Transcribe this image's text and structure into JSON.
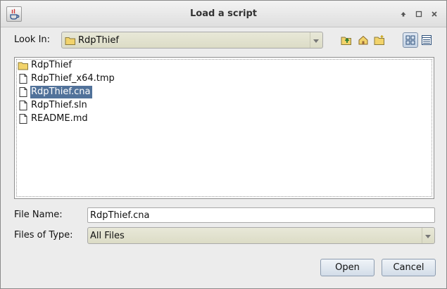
{
  "window": {
    "title": "Load a script"
  },
  "window_controls": [
    "maximize",
    "restore",
    "close"
  ],
  "look_in": {
    "label": "Look In:",
    "value": "RdpThief"
  },
  "toolbar": [
    {
      "name": "up-one-level-icon"
    },
    {
      "name": "home-icon"
    },
    {
      "name": "new-folder-icon"
    },
    {
      "name": "list-view-icon",
      "active": true
    },
    {
      "name": "details-view-icon",
      "active": false
    }
  ],
  "files": [
    {
      "name": "RdpThief",
      "type": "folder",
      "selected": false
    },
    {
      "name": "RdpThief_x64.tmp",
      "type": "file",
      "selected": false
    },
    {
      "name": "RdpThief.cna",
      "type": "file",
      "selected": true
    },
    {
      "name": "RdpThief.sln",
      "type": "file",
      "selected": false
    },
    {
      "name": "README.md",
      "type": "file",
      "selected": false
    }
  ],
  "file_name": {
    "label": "File Name:",
    "value": "RdpThief.cna"
  },
  "files_of_type": {
    "label": "Files of Type:",
    "value": "All Files"
  },
  "buttons": {
    "open": "Open",
    "cancel": "Cancel"
  },
  "colors": {
    "selection": "#51729a",
    "combo_bg": "#dcdcc6",
    "folder": "#f2d36b"
  }
}
